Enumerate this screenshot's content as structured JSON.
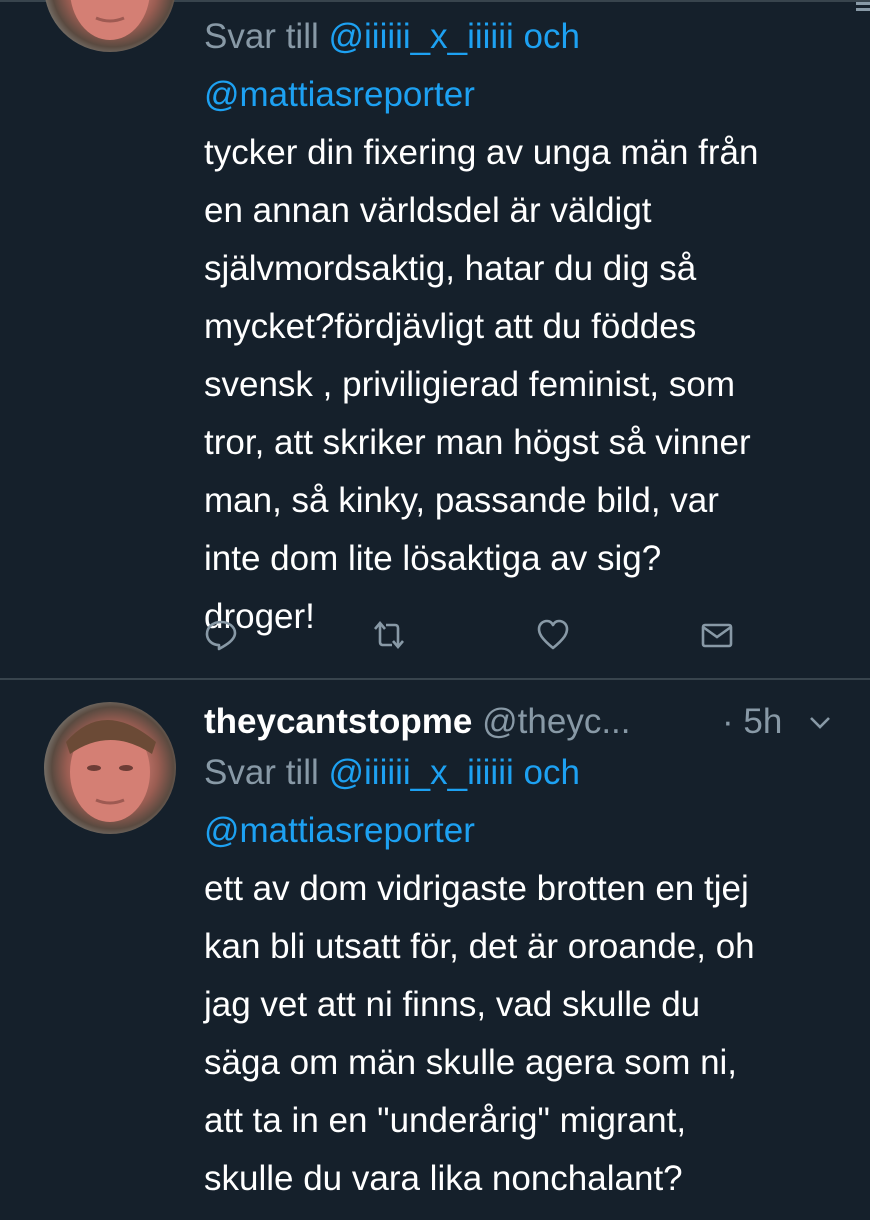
{
  "colors": {
    "background": "#15202b",
    "link": "#1da1f2",
    "secondary": "#8899a6",
    "divider": "#38444d"
  },
  "tweets": [
    {
      "reply_prefix": "Svar till",
      "mention1": "@iiiiii_x_iiiiii",
      "conj": "och",
      "mention2": "@mattiasreporter",
      "lines": [
        "tycker din fixering av unga män från",
        "en annan världsdel är väldigt",
        "självmordsaktig, hatar du dig så",
        "mycket?fördjävligt att du föddes",
        "svensk , priviligierad feminist, som",
        "tror, att skriker man högst så vinner",
        "man, så kinky, passande bild, var",
        "inte dom lite lösaktiga av sig?",
        "droger!"
      ],
      "actions": [
        "reply-icon",
        "retweet-icon",
        "like-icon",
        "message-icon"
      ]
    },
    {
      "name": "theycantstopme",
      "handle": "@theyc...",
      "time": "· 5h",
      "reply_prefix": "Svar till",
      "mention1": "@iiiiii_x_iiiiii",
      "conj": "och",
      "mention2": "@mattiasreporter",
      "lines": [
        "ett av dom vidrigaste brotten en tjej",
        "kan bli utsatt för, det är oroande, oh",
        "jag vet att ni finns, vad skulle du",
        "säga om män skulle agera som ni,",
        "att ta in en \"underårig\" migrant,",
        "skulle du vara lika nonchalant?"
      ]
    }
  ]
}
